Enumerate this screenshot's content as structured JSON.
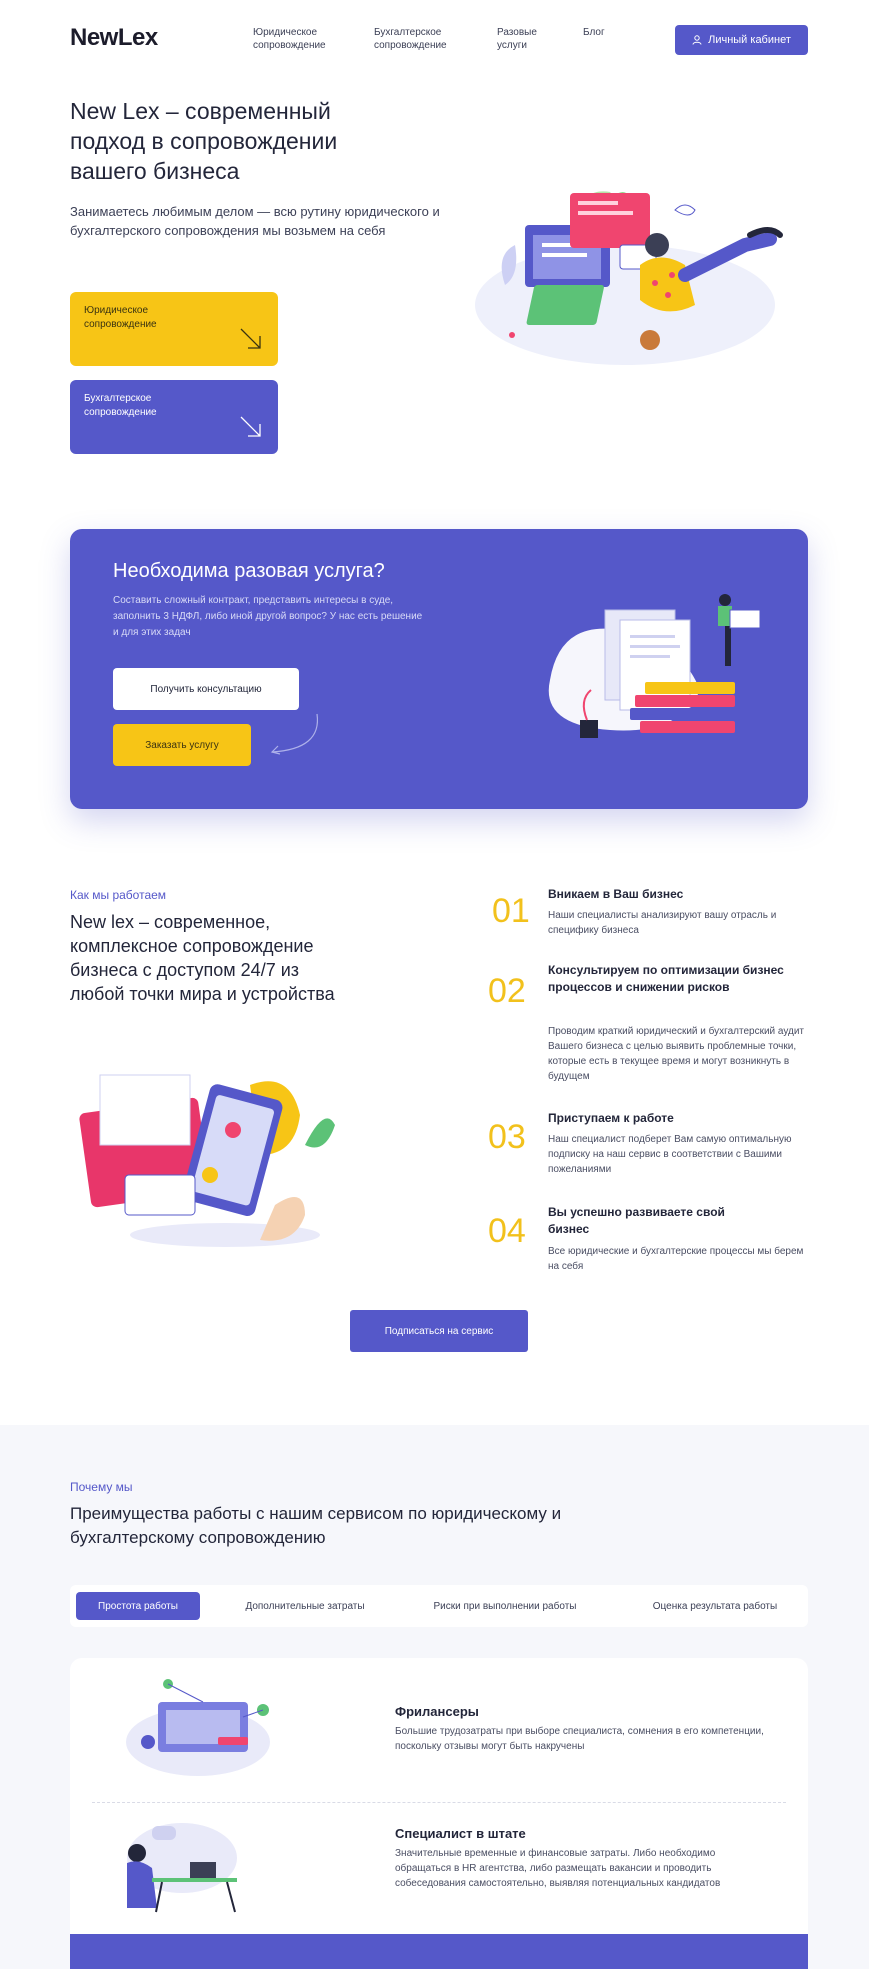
{
  "header": {
    "logo": "NewLex",
    "nav": [
      {
        "label": "Юридическое сопровождение"
      },
      {
        "label": "Бухгалтерское сопровождение"
      },
      {
        "label": "Разовые услуги"
      },
      {
        "label": "Блог"
      }
    ],
    "cabinet_label": "Личный кабинет",
    "cabinet_icon": "user-icon"
  },
  "hero": {
    "title": "New Lex – современный подход в сопровождении вашего бизнеса",
    "subtitle": "Занимаетесь любимым делом — всю рутину юридического и бухгалтерского сопровождения мы возьмем на себя",
    "cards": [
      {
        "label": "Юридическое сопровождение",
        "icon": "arrow-down-right-icon",
        "color": "#f7c516"
      },
      {
        "label": "Бухгалтерское сопровождение",
        "icon": "arrow-down-right-icon",
        "color": "#5558c9"
      }
    ]
  },
  "service": {
    "title": "Необходима разовая услуга?",
    "subtitle": "Составить сложный контракт, представить интересы в суде, заполнить 3 НДФЛ, либо иной другой вопрос? У нас есть решение и для этих задач",
    "consult_label": "Получить консультацию",
    "order_label": "Заказать услугу"
  },
  "how": {
    "tag": "Как мы работаем",
    "title": "New lex – современное, комплексное сопровождение бизнеса с доступом 24/7 из любой точки мира и устройства",
    "steps": [
      {
        "num": "01",
        "title": "Вникаем в Ваш бизнес",
        "text": "Наши специалисты анализируют вашу отрасль и специфику бизнеса"
      },
      {
        "num": "02",
        "title": "Консультируем по оптимизации бизнес процессов и снижении рисков",
        "text": "Проводим краткий юридический и бухгалтерский аудит Вашего бизнеса с целью выявить проблемные точки, которые есть в текущее время и могут возникнуть в будущем"
      },
      {
        "num": "03",
        "title": "Приступаем к работе",
        "text": "Наш специалист подберет Вам самую оптимальную подписку на наш сервис в соответствии с Вашими пожеланиями"
      },
      {
        "num": "04",
        "title": "Вы успешно развиваете свой бизнес",
        "text": "Все юридические и бухгалтерские процессы мы берем на себя"
      }
    ],
    "subscribe_label": "Подписаться на сервис"
  },
  "why": {
    "tag": "Почему мы",
    "title": "Преимущества работы с нашим сервисом по юридическому и бухгалтерскому сопровождению",
    "tabs": [
      {
        "label": "Простота работы",
        "active": true
      },
      {
        "label": "Дополнительные затраты",
        "active": false
      },
      {
        "label": "Риски при выполнении работы",
        "active": false
      },
      {
        "label": "Оценка результата работы",
        "active": false
      }
    ],
    "items": [
      {
        "title": "Фрилансеры",
        "text": "Большие трудозатраты при выборе специалиста, сомнения в его компетенции, поскольку отзывы могут быть накручены"
      },
      {
        "title": "Специалист в штате",
        "text": "Значительные временные и финансовые затраты. Либо необходимо обращаться в HR агентства, либо размещать вакансии и проводить собеседования самостоятельно, выявляя потенциальных кандидатов"
      }
    ]
  },
  "colors": {
    "accent": "#5558c9",
    "yellow": "#f7c516",
    "text": "#23263a"
  }
}
